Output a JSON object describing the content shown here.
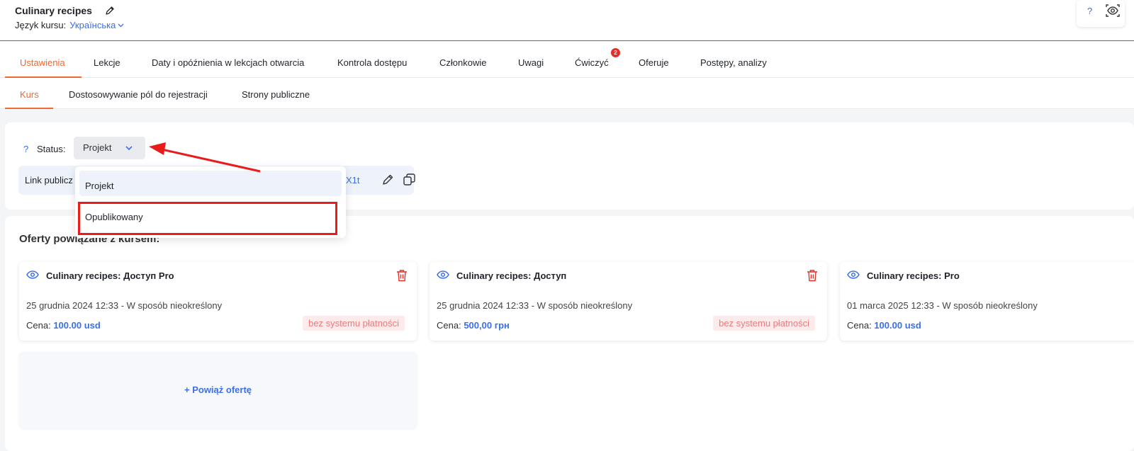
{
  "header": {
    "course_title": "Culinary recipes",
    "lang_label": "Język kursu:",
    "lang_value": "Українська",
    "help": "?"
  },
  "tabs_main": [
    {
      "label": "Ustawienia",
      "active": true
    },
    {
      "label": "Lekcje"
    },
    {
      "label": "Daty i opóźnienia w lekcjach otwarcia"
    },
    {
      "label": "Kontrola dostępu"
    },
    {
      "label": "Członkowie"
    },
    {
      "label": "Uwagi"
    },
    {
      "label": "Ćwiczyć",
      "badge": "2"
    },
    {
      "label": "Oferuje"
    },
    {
      "label": "Postępy, analizy"
    }
  ],
  "tabs_sub": [
    {
      "label": "Kurs",
      "active": true
    },
    {
      "label": "Dostosowywanie pól do rejestracji"
    },
    {
      "label": "Strony publiczne"
    }
  ],
  "status": {
    "help": "?",
    "label": "Status:",
    "value": "Projekt",
    "options": [
      "Projekt",
      "Opublikowany"
    ]
  },
  "public_link": {
    "label": "Link publicz",
    "tail": "X1t"
  },
  "offers": {
    "title": "Oferty powiązane z kursem:",
    "items": [
      {
        "name": "Culinary recipes: Доступ Pro",
        "date": "25 grudnia 2024 12:33 - W sposób nieokreślony",
        "price_label": "Cena:",
        "price": "100.00 usd",
        "badge": "bez systemu płatności"
      },
      {
        "name": "Culinary recipes: Доступ",
        "date": "25 grudnia 2024 12:33 - W sposób nieokreślony",
        "price_label": "Cena:",
        "price": "500,00 грн",
        "badge": "bez systemu płatności"
      },
      {
        "name": "Culinary recipes: Pro",
        "date": "01 marca 2025 12:33 - W sposób nieokreślony",
        "price_label": "Cena:",
        "price": "100.00 usd",
        "badge": ""
      }
    ],
    "add_label": "+ Powiąż ofertę"
  },
  "colors": {
    "accent": "#3b6fe8",
    "active_tab": "#ee6a33",
    "annotation": "#ea1b1b",
    "badge": "#e0302b"
  }
}
